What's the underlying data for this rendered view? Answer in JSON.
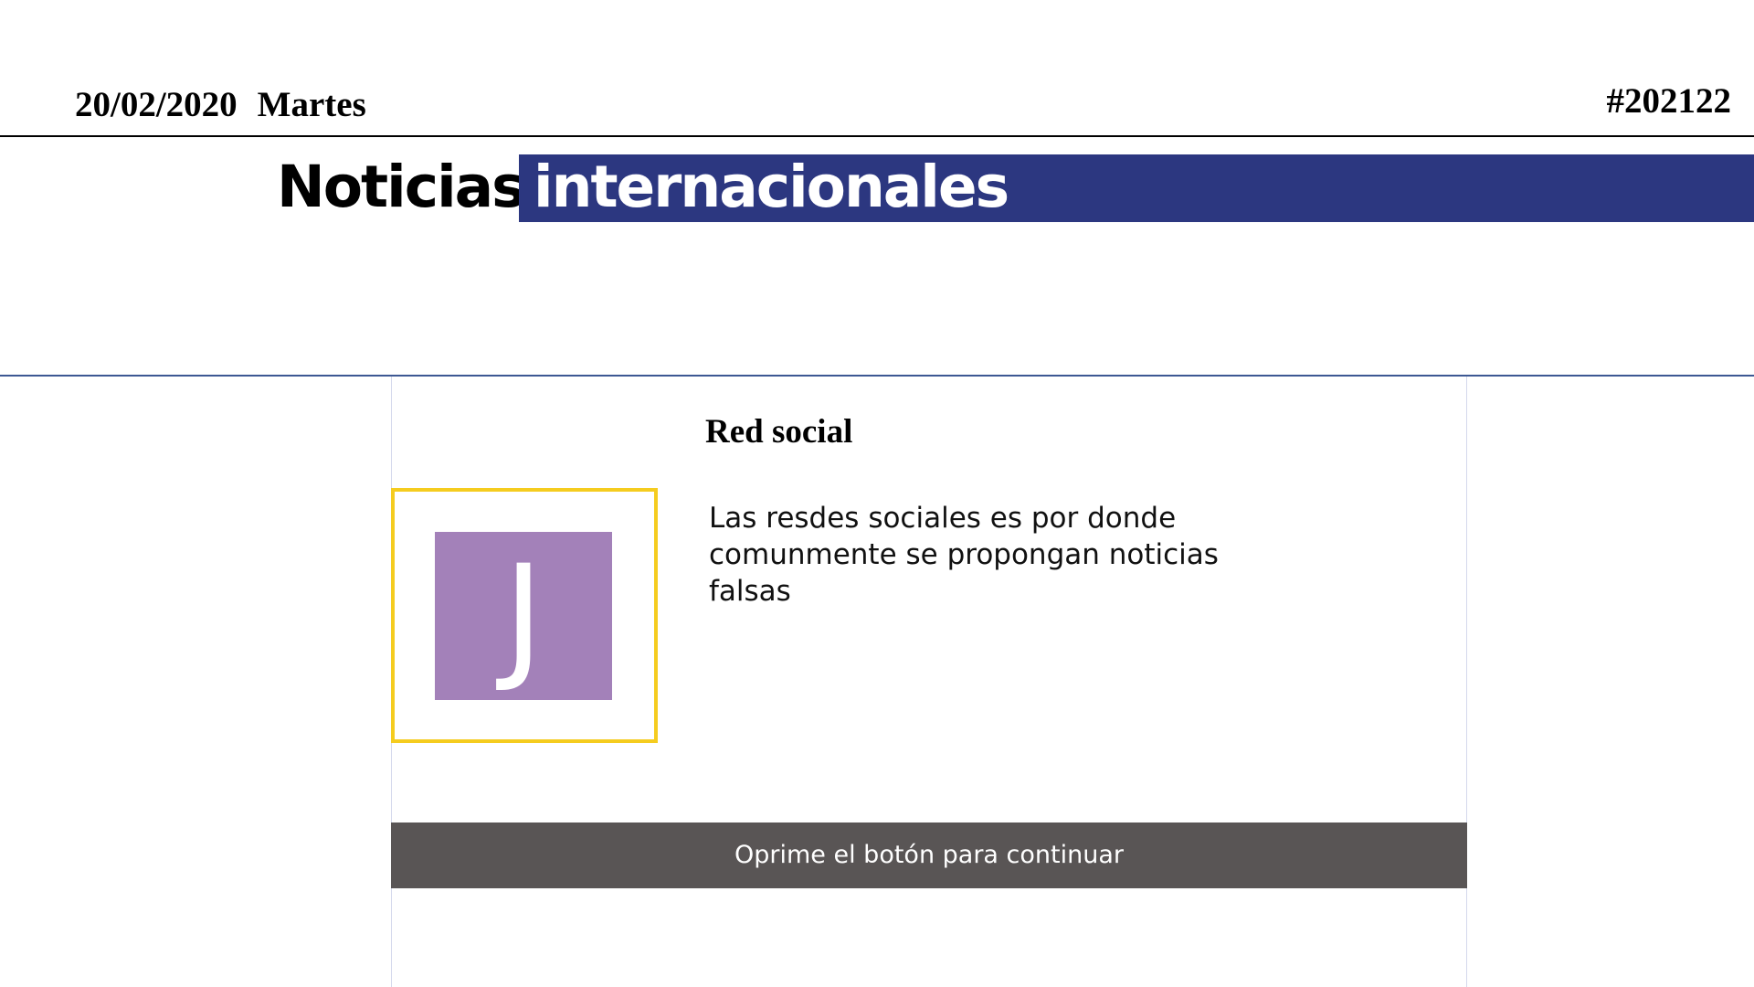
{
  "header": {
    "date": "20/02/2020",
    "weekday": "Martes",
    "issue_number": "#202122"
  },
  "masthead": {
    "title_black": "Noticias",
    "title_highlight": "internacionales"
  },
  "article": {
    "section_title": "Red social",
    "avatar_letter": "J",
    "body": "Las resdes sociales es por donde comunmente se propongan noticias falsas"
  },
  "actions": {
    "continue_label": "Oprime el botón para continuar"
  },
  "colors": {
    "masthead_bar": "#2c3780",
    "avatar_frame": "#f5cc1f",
    "avatar_background": "#a381b9",
    "button_background": "#595555",
    "section_rule": "#3d5893"
  }
}
